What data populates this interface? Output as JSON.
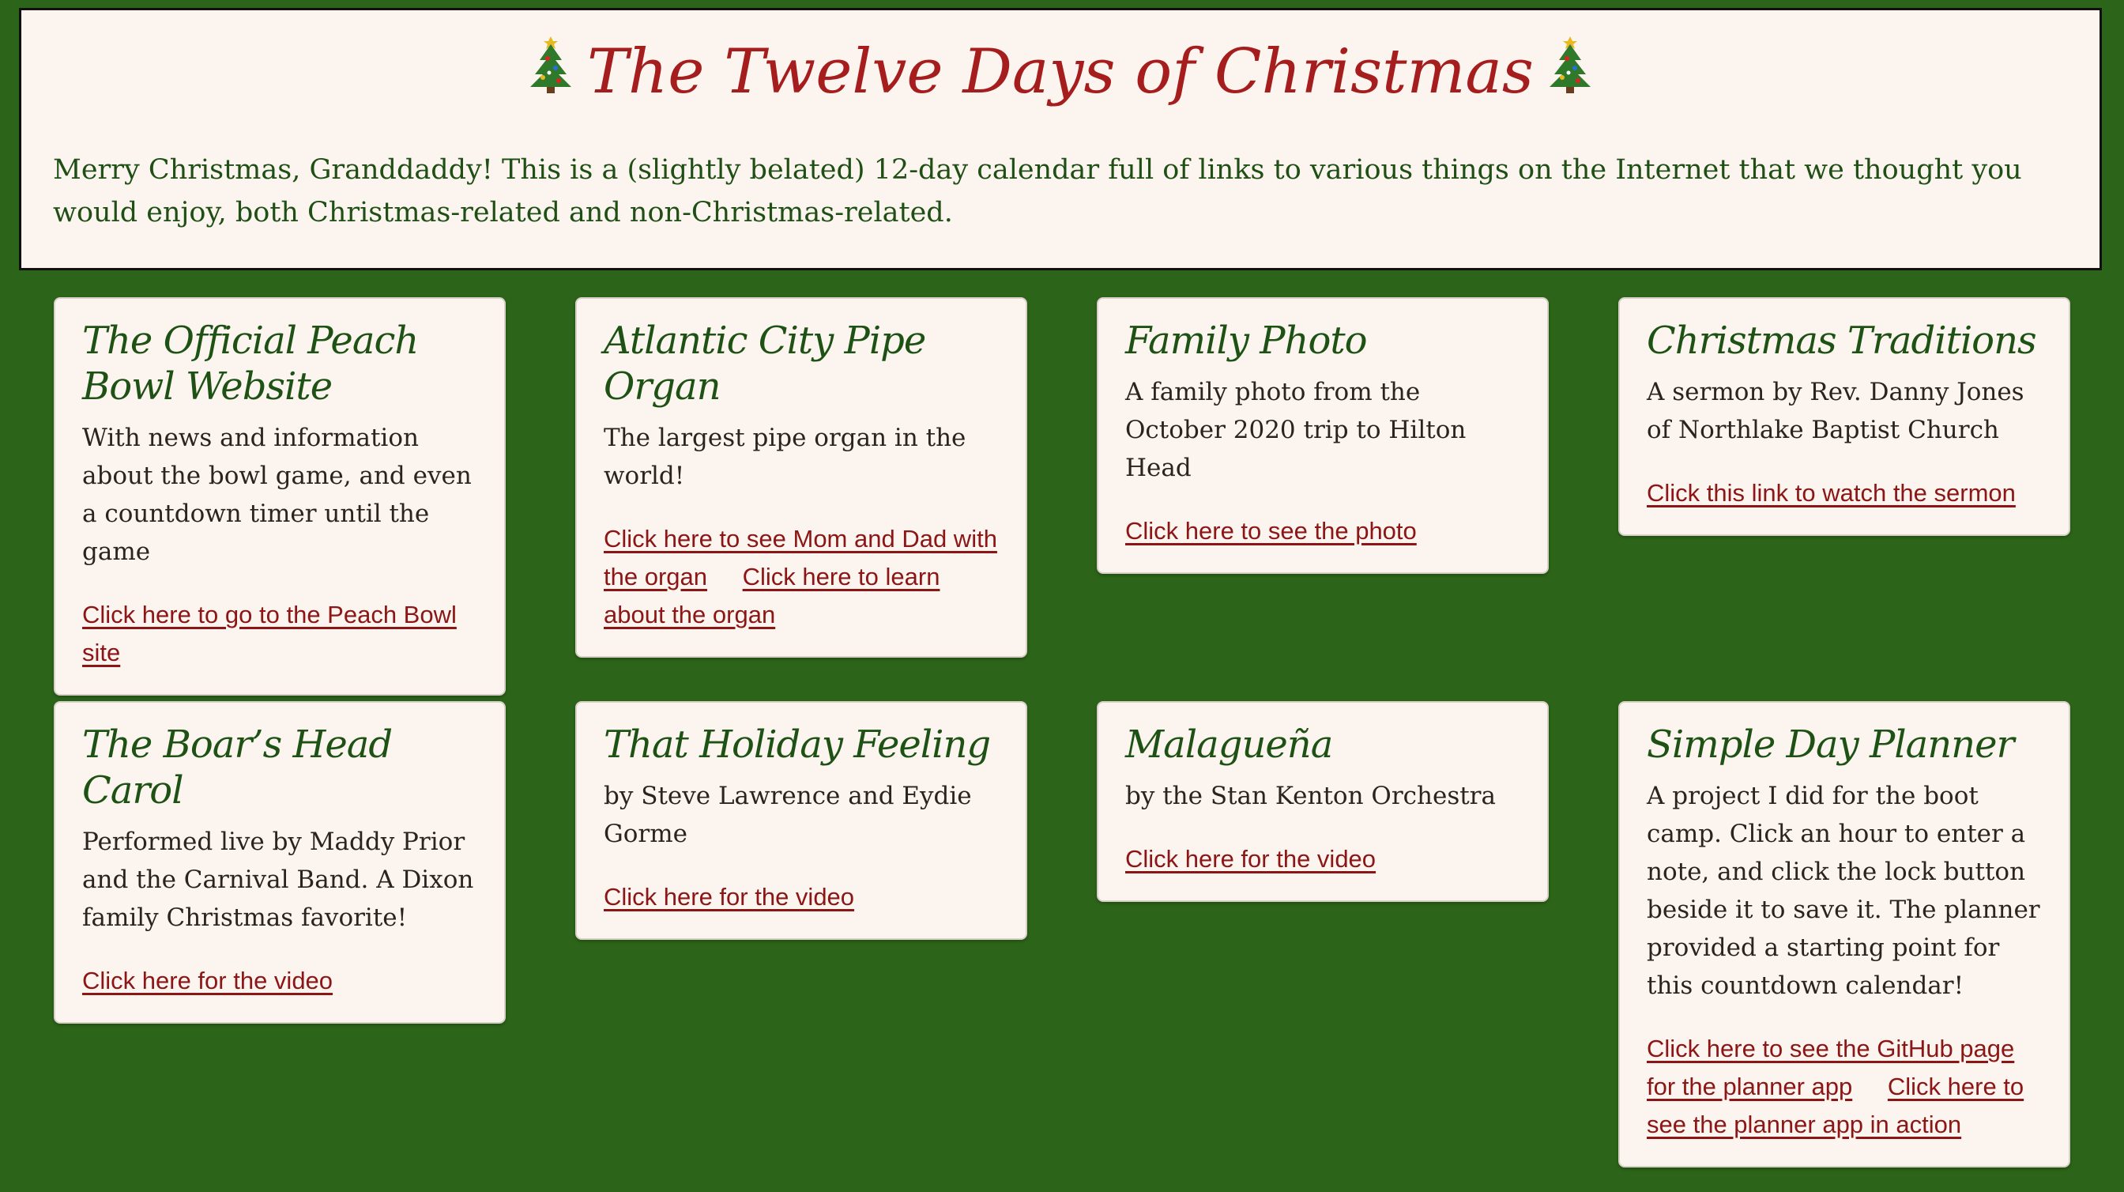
{
  "header": {
    "title": "The Twelve Days of Christmas",
    "intro": "Merry Christmas, Granddaddy! This is a (slightly belated) 12-day calendar full of links to various things on the Internet that we thought you would enjoy, both Christmas-related and non-Christmas-related."
  },
  "icons": {
    "title_left": "christmas-tree-icon",
    "title_right": "christmas-tree-icon"
  },
  "colors": {
    "background": "#2c6519",
    "card_background": "#fbf4ef",
    "title_red": "#a51d1d",
    "card_title_green": "#1e5214",
    "link_red": "#8c1616"
  },
  "cards": [
    {
      "title": "The Official Peach Bowl Website",
      "text": "With news and information about the bowl game, and even a countdown timer until the game",
      "links": [
        "Click here to go to the Peach Bowl site"
      ]
    },
    {
      "title": "Atlantic City Pipe Organ",
      "text": "The largest pipe organ in the world!",
      "links": [
        "Click here to see Mom and Dad with the organ",
        "Click here to learn about the organ"
      ]
    },
    {
      "title": "Family Photo",
      "text": "A family photo from the October 2020 trip to Hilton Head",
      "links": [
        "Click here to see the photo"
      ]
    },
    {
      "title": "Christmas Traditions",
      "text": "A sermon by Rev. Danny Jones of Northlake Baptist Church",
      "links": [
        "Click this link to watch the sermon"
      ]
    },
    {
      "title": "The Boar’s Head Carol",
      "text": "Performed live by Maddy Prior and the Carnival Band. A Dixon family Christmas favorite!",
      "links": [
        "Click here for the video"
      ]
    },
    {
      "title": "That Holiday Feeling",
      "text": "by Steve Lawrence and Eydie Gorme",
      "links": [
        "Click here for the video"
      ]
    },
    {
      "title": "Malagueña",
      "text": "by the Stan Kenton Orchestra",
      "links": [
        "Click here for the video"
      ]
    },
    {
      "title": "Simple Day Planner",
      "text": "A project I did for the boot camp. Click an hour to enter a note, and click the lock button beside it to save it. The planner provided a starting point for this countdown calendar!",
      "links": [
        "Click here to see the GitHub page for the planner app",
        "Click here to see the planner app in action"
      ]
    }
  ]
}
